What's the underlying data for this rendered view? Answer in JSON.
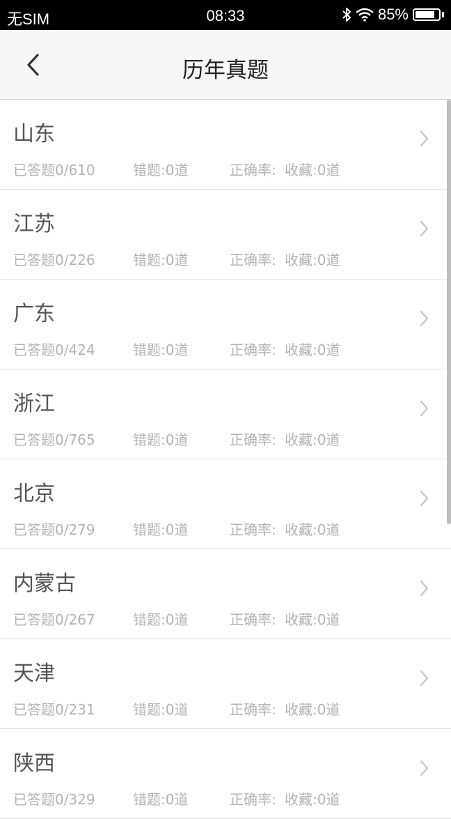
{
  "status_bar": {
    "carrier": "无SIM",
    "time": "08:33",
    "battery_text": "85%",
    "battery_level": 0.85
  },
  "nav": {
    "title": "历年真题",
    "back_icon": "chevron-left-icon"
  },
  "list": {
    "items": [
      {
        "title": "山东",
        "answered": "已答题0/610",
        "wrong": "错题:0道",
        "rate": "正确率:",
        "favorites": "收藏:0道"
      },
      {
        "title": "江苏",
        "answered": "已答题0/226",
        "wrong": "错题:0道",
        "rate": "正确率:",
        "favorites": "收藏:0道"
      },
      {
        "title": "广东",
        "answered": "已答题0/424",
        "wrong": "错题:0道",
        "rate": "正确率:",
        "favorites": "收藏:0道"
      },
      {
        "title": "浙江",
        "answered": "已答题0/765",
        "wrong": "错题:0道",
        "rate": "正确率:",
        "favorites": "收藏:0道"
      },
      {
        "title": "北京",
        "answered": "已答题0/279",
        "wrong": "错题:0道",
        "rate": "正确率:",
        "favorites": "收藏:0道"
      },
      {
        "title": "内蒙古",
        "answered": "已答题0/267",
        "wrong": "错题:0道",
        "rate": "正确率:",
        "favorites": "收藏:0道"
      },
      {
        "title": "天津",
        "answered": "已答题0/231",
        "wrong": "错题:0道",
        "rate": "正确率:",
        "favorites": "收藏:0道"
      },
      {
        "title": "陕西",
        "answered": "已答题0/329",
        "wrong": "错题:0道",
        "rate": "正确率:",
        "favorites": "收藏:0道"
      }
    ]
  },
  "colors": {
    "status_bar_bg": "#000000",
    "nav_bg": "#f7f7f7",
    "title_text": "#555555",
    "meta_text": "#b3b3b3",
    "chevron": "#c7c7c7"
  }
}
